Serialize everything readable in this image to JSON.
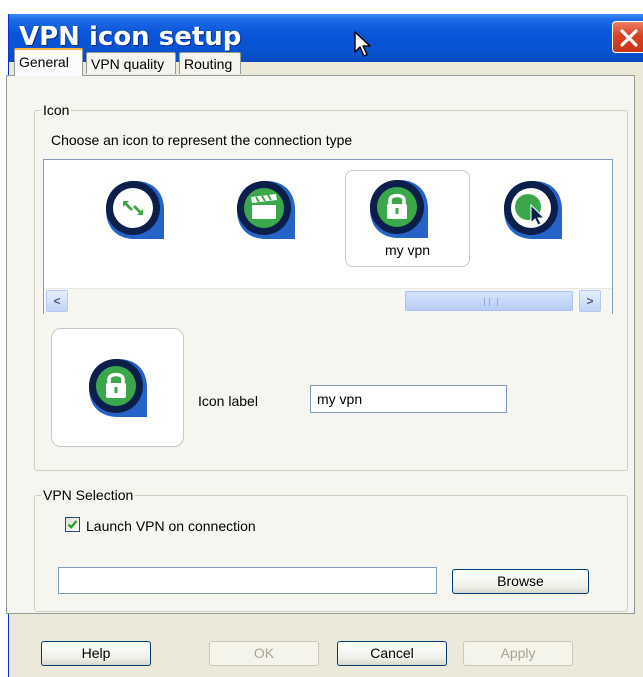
{
  "window": {
    "title": "VPN icon setup",
    "close_icon": "close-icon"
  },
  "tabs": [
    {
      "label": "General",
      "active": true
    },
    {
      "label": "VPN quality",
      "active": false
    },
    {
      "label": "Routing",
      "active": false
    }
  ],
  "icon_group": {
    "legend": "Icon",
    "instruction": "Choose an icon to represent the connection type",
    "icons": [
      {
        "name": "arrows-exchange-icon",
        "caption": ""
      },
      {
        "name": "film-clapper-icon",
        "caption": ""
      },
      {
        "name": "padlock-icon",
        "caption": "my vpn",
        "selected": true
      },
      {
        "name": "globe-cursor-icon",
        "caption": ""
      }
    ],
    "scroll_left": "<",
    "scroll_right": ">",
    "preview_icon": "padlock-icon",
    "label_caption": "Icon label",
    "label_value": "my vpn"
  },
  "vpn_group": {
    "legend": "VPN Selection",
    "checkbox_label": "Launch VPN on connection",
    "checkbox_checked": true,
    "path_value": "",
    "browse_label": "Browse"
  },
  "buttons": {
    "help": "Help",
    "ok": "OK",
    "cancel": "Cancel",
    "apply": "Apply"
  },
  "colors": {
    "titlebar": "#0a55d8",
    "icon_green": "#3aa84a",
    "icon_navy": "#0c1f4a",
    "icon_blue": "#2563c9"
  }
}
